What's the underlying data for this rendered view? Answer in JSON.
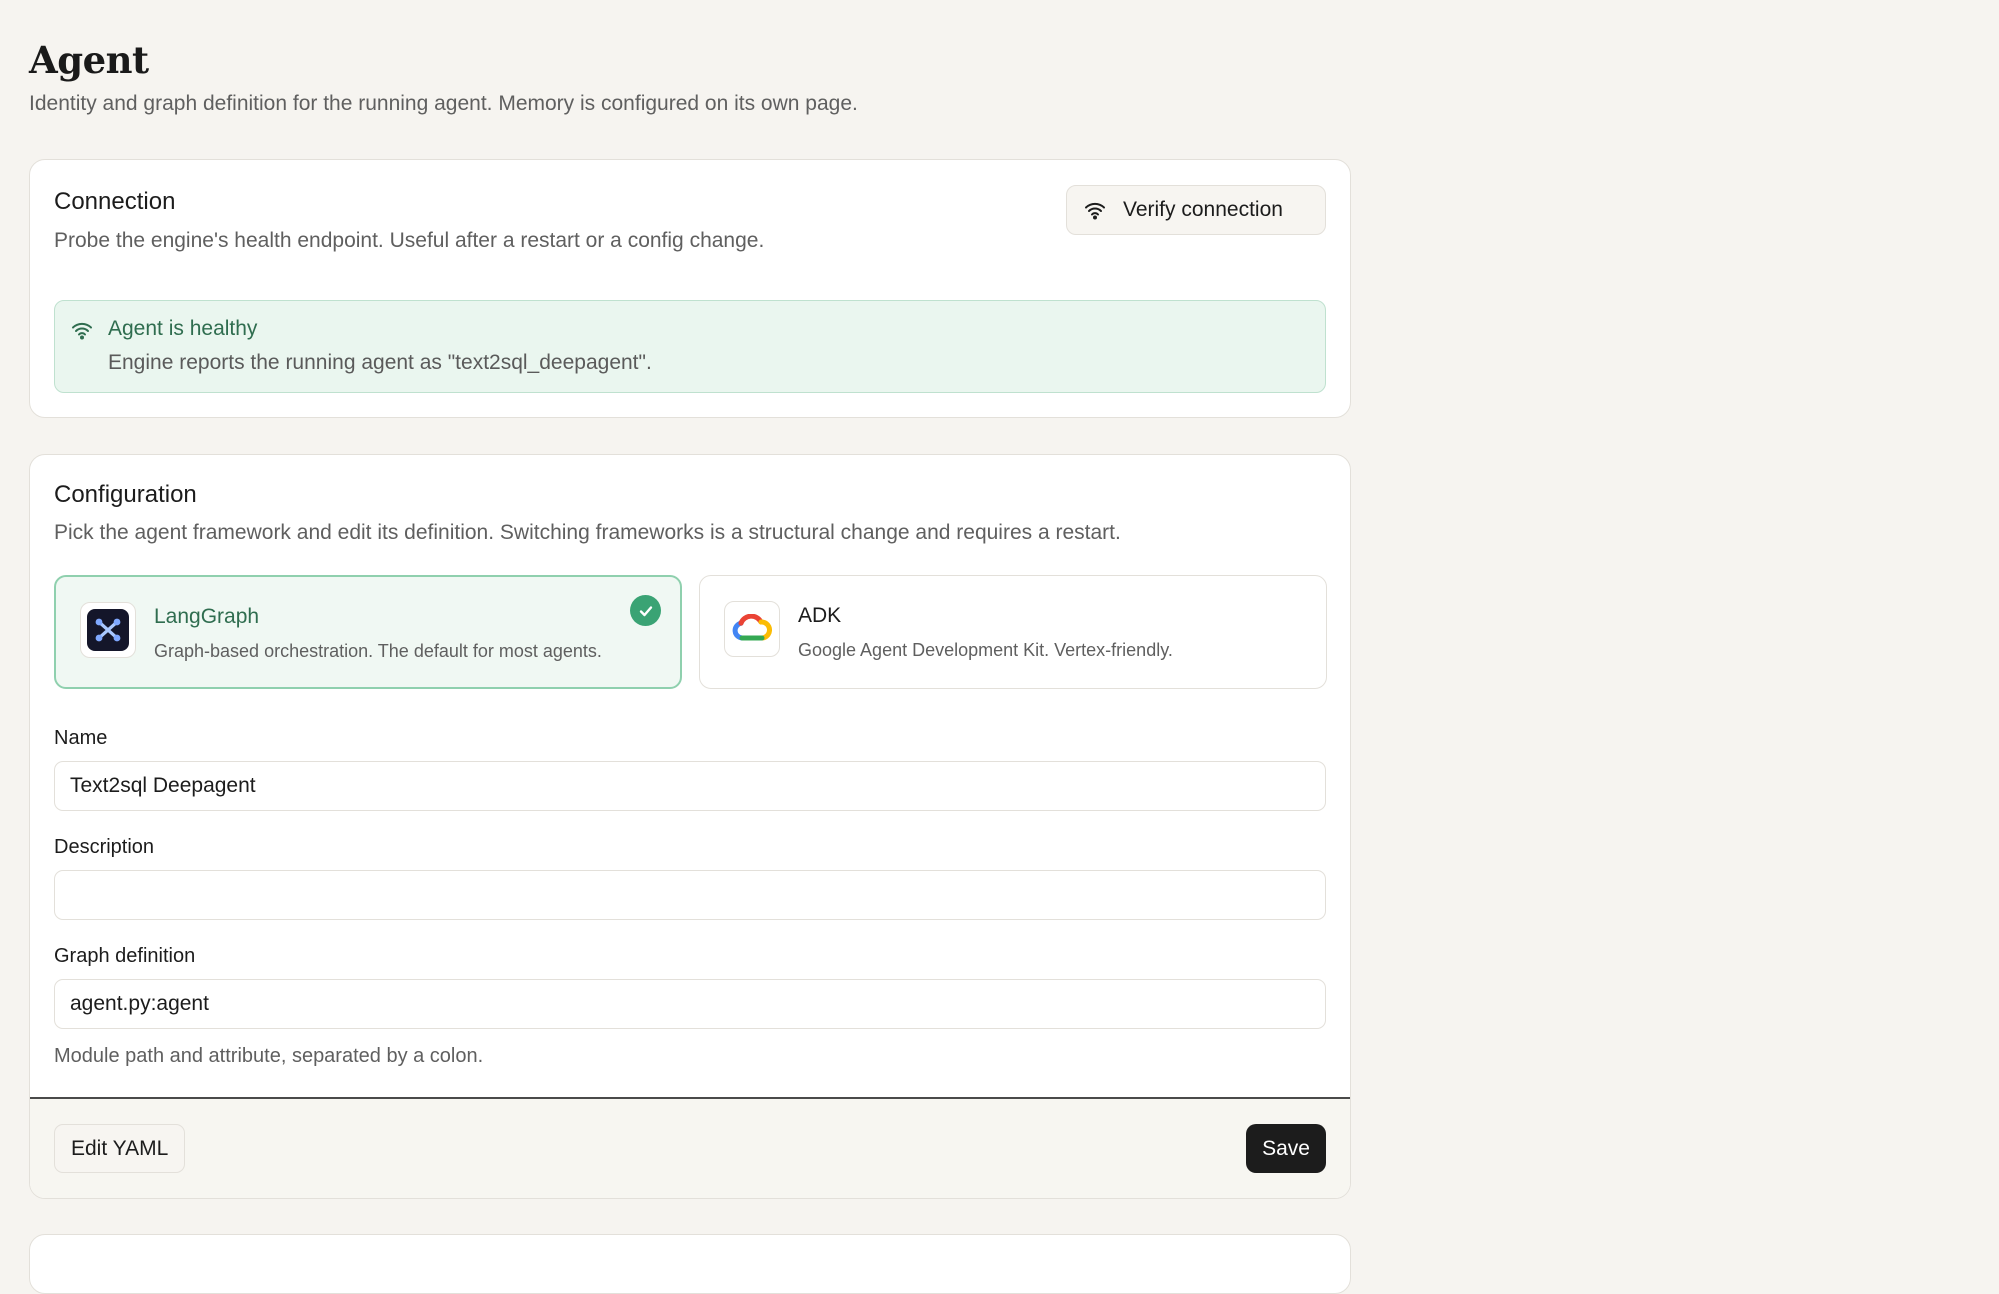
{
  "page": {
    "title": "Agent",
    "subtitle": "Identity and graph definition for the running agent. Memory is configured on its own page."
  },
  "connection": {
    "title": "Connection",
    "description": "Probe the engine's health endpoint. Useful after a restart or a config change.",
    "verify_label": "Verify connection",
    "verify_icon": "wifi-icon",
    "status": {
      "icon": "wifi-icon",
      "title": "Agent is healthy",
      "text": "Engine reports the running agent as \"text2sql_deepagent\".",
      "color": "#2f6d4f"
    }
  },
  "configuration": {
    "title": "Configuration",
    "description": "Pick the agent framework and edit its definition. Switching frameworks is a structural change and requires a restart.",
    "frameworks": [
      {
        "name": "LangGraph",
        "description": "Graph-based orchestration. The default for most agents.",
        "icon": "langgraph-logo-icon",
        "selected": true
      },
      {
        "name": "ADK",
        "description": "Google Agent Development Kit. Vertex-friendly.",
        "icon": "google-cloud-logo-icon",
        "selected": false
      }
    ],
    "fields": {
      "name": {
        "label": "Name",
        "value": "Text2sql Deepagent"
      },
      "description": {
        "label": "Description",
        "value": ""
      },
      "graph": {
        "label": "Graph definition",
        "value": "agent.py:agent",
        "hint": "Module path and attribute, separated by a colon."
      }
    },
    "footer": {
      "edit_yaml_label": "Edit YAML",
      "save_label": "Save"
    }
  },
  "colors": {
    "accent_green": "#3aa374",
    "healthy_bg": "#eaf6ef",
    "primary_button": "#1c1c1c",
    "page_bg": "#f6f4f0"
  }
}
